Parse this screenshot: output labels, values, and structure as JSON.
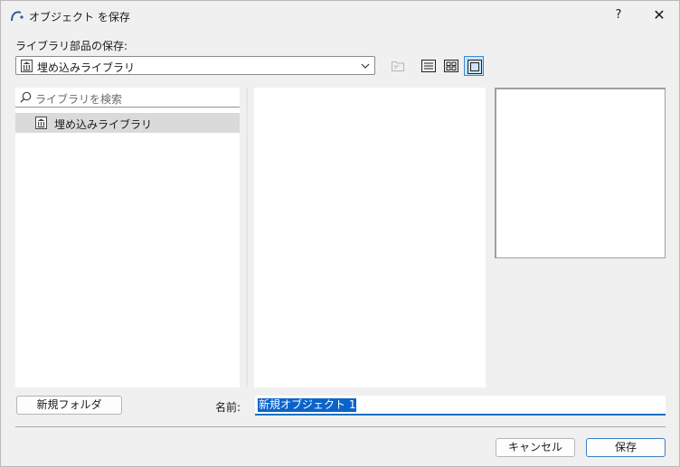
{
  "window": {
    "title": "オブジェクト を保存",
    "help_label": "?",
    "close_label": "✕"
  },
  "save_to": {
    "label": "ライブラリ部品の保存:",
    "selected_library": "埋め込みライブラリ",
    "dropdown_icon": "chevron-down-icon",
    "library_icon": "library-icon"
  },
  "toolbar": {
    "buttons": [
      {
        "name": "new-folder-icon",
        "state": "disabled"
      },
      {
        "name": "list-view-icon",
        "state": "normal"
      },
      {
        "name": "grid-view-icon",
        "state": "normal"
      },
      {
        "name": "preview-view-icon",
        "state": "active"
      }
    ]
  },
  "search": {
    "placeholder": "ライブラリを検索"
  },
  "tree": {
    "items": [
      {
        "label": "埋め込みライブラリ",
        "selected": true
      }
    ]
  },
  "footer": {
    "new_folder_label": "新規フォルダ",
    "name_label": "名前:",
    "name_value": "新規オブジェクト 1",
    "cancel_label": "キャンセル",
    "save_label": "保存"
  },
  "colors": {
    "accent": "#1d6fc0",
    "selection": "#0a64c8",
    "active_tool": "#cce4f7",
    "tree_selected": "#dadada"
  }
}
